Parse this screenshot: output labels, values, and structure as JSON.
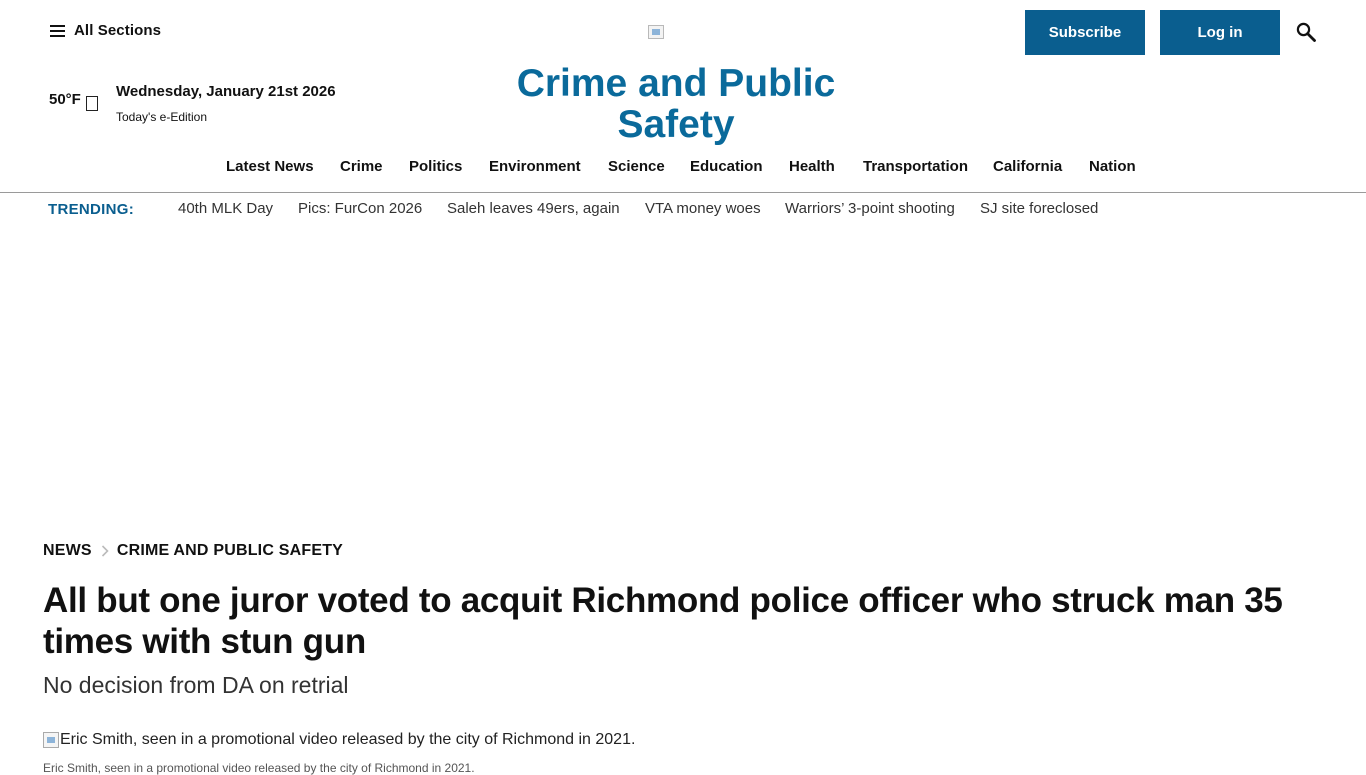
{
  "header": {
    "all_sections_label": "All Sections",
    "subscribe_label": "Subscribe",
    "login_label": "Log in",
    "weather_temp": "50°F",
    "date": "Wednesday, January 21st 2026",
    "eedition_label": "Today's e-Edition",
    "section_title": "Crime and Public Safety"
  },
  "nav": {
    "items": [
      "Latest News",
      "Crime",
      "Politics",
      "Environment",
      "Science",
      "Education",
      "Health",
      "Transportation",
      "California",
      "Nation"
    ]
  },
  "trending": {
    "label": "TRENDING:",
    "items": [
      "40th MLK Day",
      "Pics: FurCon 2026",
      "Saleh leaves 49ers, again",
      "VTA money woes",
      "Warriors’ 3-point shooting",
      "SJ site foreclosed"
    ]
  },
  "article": {
    "breadcrumb": [
      "NEWS",
      "CRIME AND PUBLIC SAFETY"
    ],
    "headline": "All but one juror voted to acquit Richmond police officer who struck man 35 times with stun gun",
    "subhead": "No decision from DA on retrial",
    "image_alt": "Eric Smith, seen in a promotional video released by the city of Richmond in 2021.",
    "caption": "Eric Smith, seen in a promotional video released by the city of Richmond in 2021."
  },
  "colors": {
    "brand_blue": "#0a5e8f",
    "title_blue": "#0a6a9b"
  },
  "icons": [
    "hamburger-icon",
    "search-icon",
    "weather-icon",
    "chevron-right-icon"
  ]
}
